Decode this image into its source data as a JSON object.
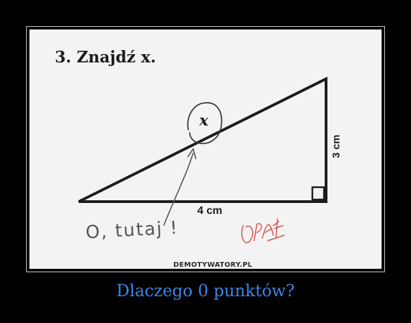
{
  "question": {
    "title": "3. Znajdź x."
  },
  "figure": {
    "variable": "x",
    "bottom_side": "4 cm",
    "right_side": "3 cm",
    "handwritten_answer": "O, tutaj !",
    "grade_scribble": "Opa!"
  },
  "watermark": "DEMOTYWATORY.PL",
  "caption": "Dlaczego 0 punktów?",
  "colors": {
    "background": "#000000",
    "paper": "#f3f3f3",
    "ink": "#1c1c1c",
    "pencil": "#555555",
    "red_pen": "#d9534f",
    "caption": "#3a87e6"
  }
}
